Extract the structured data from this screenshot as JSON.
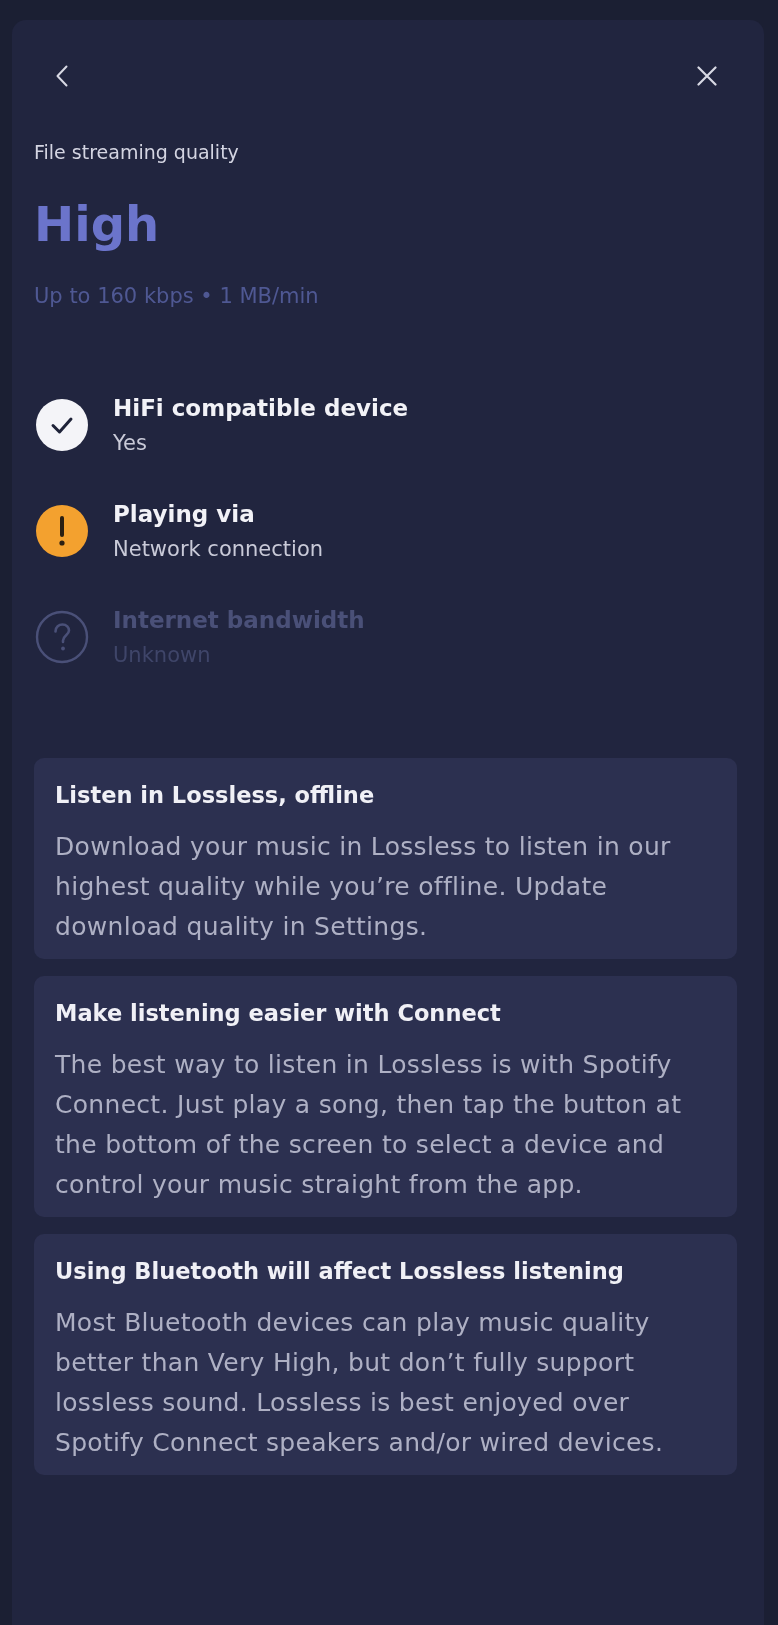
{
  "quality": {
    "label": "File streaming quality",
    "value": "High",
    "detail": "Up to 160 kbps • 1 MB/min"
  },
  "checks": [
    {
      "kind": "check",
      "title": "HiFi compatible device",
      "value": "Yes",
      "disabled": false
    },
    {
      "kind": "warning",
      "title": "Playing via",
      "value": "Network connection",
      "disabled": false
    },
    {
      "kind": "unknown",
      "title": "Internet bandwidth",
      "value": "Unknown",
      "disabled": true
    }
  ],
  "cards": [
    {
      "title": "Listen in Lossless, offline",
      "body": "Download your music in Lossless to listen in our highest quality while you’re offline. Update download quality in Settings."
    },
    {
      "title": "Make listening easier with Connect",
      "body": "The best way to listen in Lossless is with Spotify Connect. Just play a song, then tap the button at the bottom of the screen to select a device and control your music straight from the app."
    },
    {
      "title": "Using Bluetooth will affect Lossless listening",
      "body": "Most Bluetooth devices can play music quality better than Very High, but don’t fully support lossless sound. Lossless is best enjoyed over Spotify Connect speakers and/or wired devices."
    }
  ]
}
